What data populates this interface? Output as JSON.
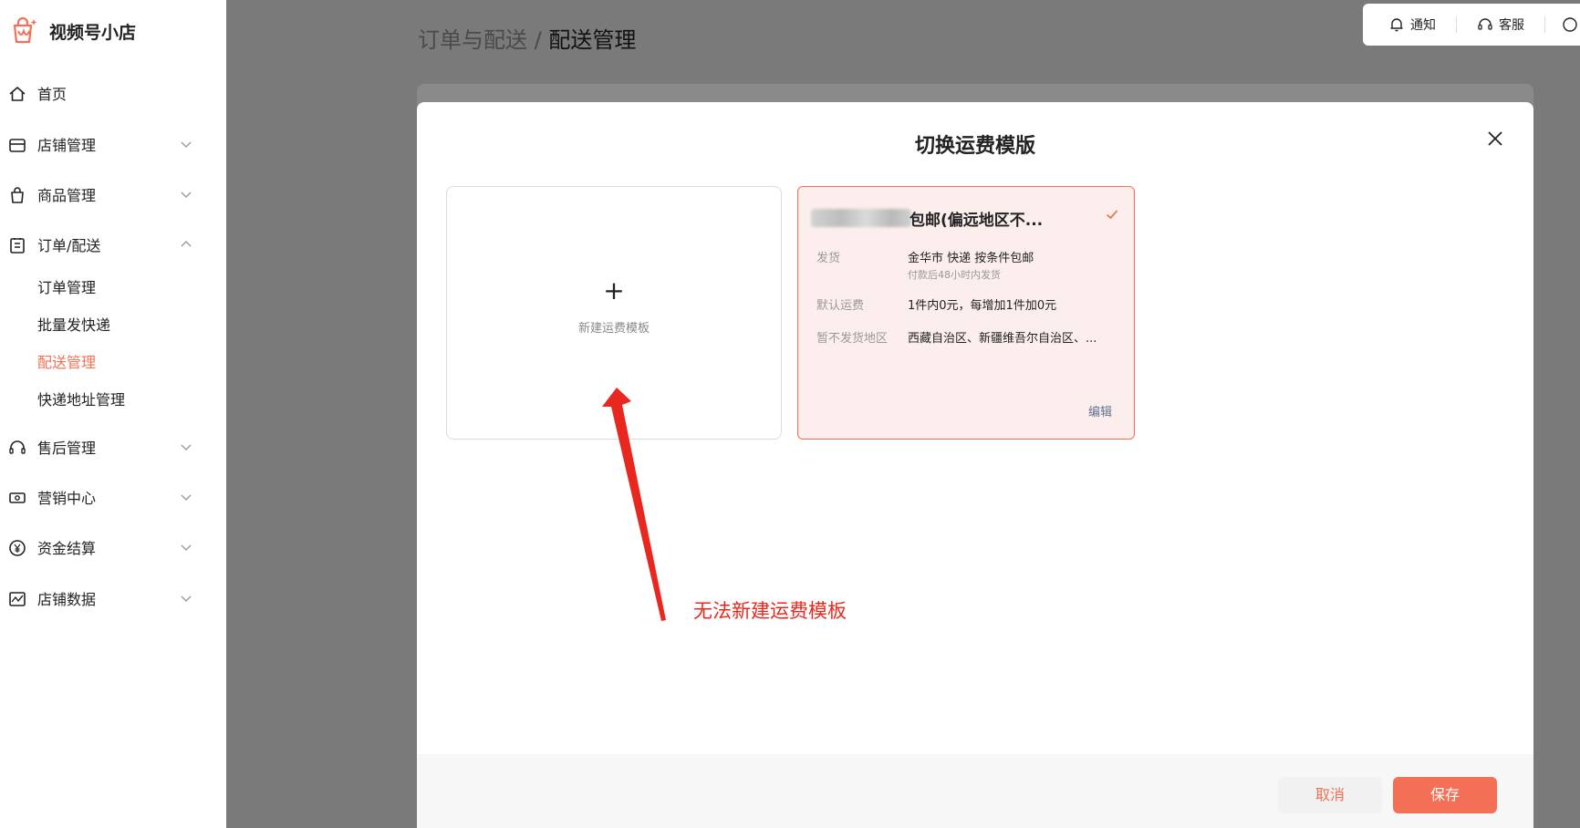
{
  "app": {
    "title": "视频号小店"
  },
  "sidebar": {
    "items": [
      {
        "label": "首页"
      },
      {
        "label": "店铺管理"
      },
      {
        "label": "商品管理"
      },
      {
        "label": "订单/配送"
      },
      {
        "label": "售后管理"
      },
      {
        "label": "营销中心"
      },
      {
        "label": "资金结算"
      },
      {
        "label": "店铺数据"
      }
    ],
    "sub_items": [
      {
        "label": "订单管理"
      },
      {
        "label": "批量发快递"
      },
      {
        "label": "配送管理"
      },
      {
        "label": "快递地址管理"
      }
    ],
    "active_color": "#f36f56"
  },
  "breadcrumb": {
    "parent": "订单与配送",
    "separator": "/",
    "current": "配送管理"
  },
  "topbar": {
    "notify_label": "通知",
    "service_label": "客服"
  },
  "modal": {
    "title": "切换运费模版",
    "new_card": {
      "plus": "+",
      "label": "新建运费模板"
    },
    "template": {
      "name_visible": "包邮(偏远地区不...",
      "rows": [
        {
          "label": "发货",
          "value": "金华市 快递 按条件包邮",
          "sub": "付款后48小时内发货"
        },
        {
          "label": "默认运费",
          "value": "1件内0元，每增加1件加0元"
        },
        {
          "label": "暂不发货地区",
          "value": "西藏自治区、新疆维吾尔自治区、..."
        }
      ],
      "edit_label": "编辑"
    },
    "cancel_label": "取消",
    "save_label": "保存"
  },
  "annotation": {
    "text": "无法新建运费模板",
    "color": "#e8281e"
  }
}
